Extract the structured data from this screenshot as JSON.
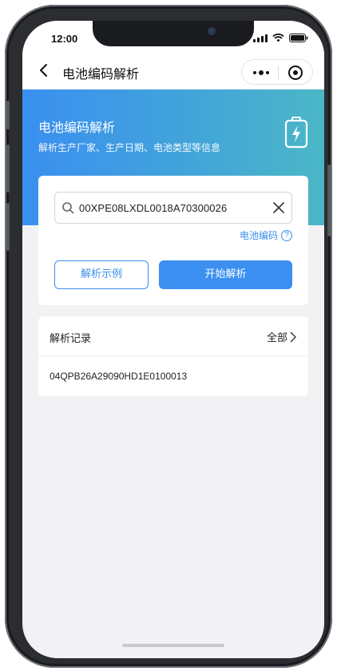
{
  "status_bar": {
    "time": "12:00"
  },
  "navbar": {
    "title": "电池编码解析"
  },
  "banner": {
    "title": "电池编码解析",
    "subtitle": "解析生产厂家、生产日期、电池类型等信息"
  },
  "search": {
    "value": "00XPE08LXDL0018A70300026"
  },
  "code_link": {
    "label": "电池编码",
    "help_glyph": "?"
  },
  "actions": {
    "example_label": "解析示例",
    "start_label": "开始解析"
  },
  "history": {
    "title": "解析记录",
    "all_label": "全部",
    "items": [
      "04QPB26A29090HD1E0100013"
    ]
  },
  "colors": {
    "accent": "#3a8ff0",
    "banner_end": "#4bb7c6",
    "background": "#f2f2f4"
  }
}
